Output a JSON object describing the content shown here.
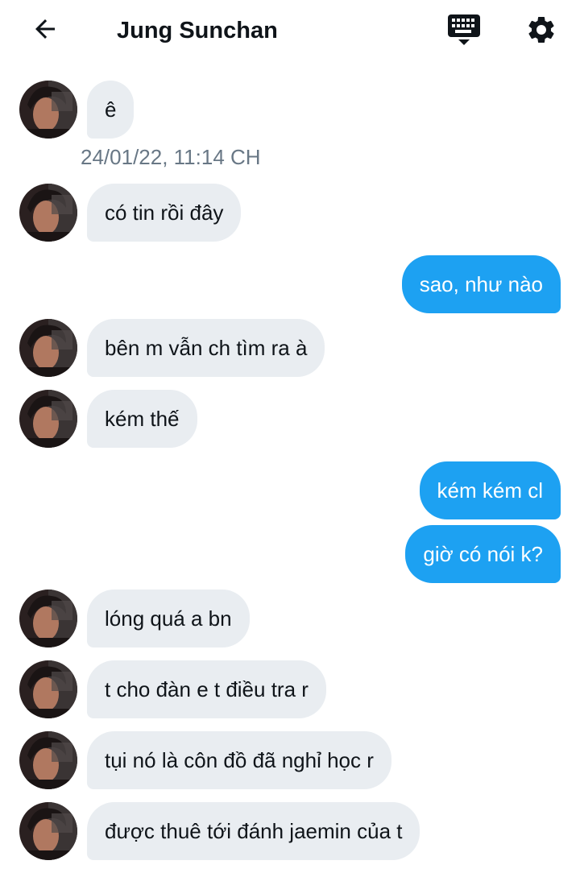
{
  "header": {
    "title": "Jung Sunchan",
    "back_icon": "arrow-left-icon",
    "keyboard_icon": "keyboard-icon",
    "settings_icon": "gear-icon"
  },
  "colors": {
    "incoming_bubble": "#e9edf1",
    "outgoing_bubble": "#1da1f2",
    "timestamp": "#687785"
  },
  "messages": [
    {
      "side": "in",
      "text": "ê"
    },
    {
      "side": "in",
      "text": "có tin rồi đây"
    },
    {
      "side": "out",
      "text": "sao, như nào"
    },
    {
      "side": "in",
      "text": "bên m vẫn ch tìm ra à"
    },
    {
      "side": "in",
      "text": "kém thế"
    },
    {
      "side": "out",
      "text": "kém kém cl"
    },
    {
      "side": "out",
      "text": "giờ có nói k?"
    },
    {
      "side": "in",
      "text": "lóng quá a bn"
    },
    {
      "side": "in",
      "text": "t cho đàn e t điều tra r"
    },
    {
      "side": "in",
      "text": "tụi nó là côn đồ đã nghỉ học r"
    },
    {
      "side": "in",
      "text": "được thuê tới đánh jaemin của t"
    }
  ],
  "timestamp": "24/01/22, 11:14 CH"
}
